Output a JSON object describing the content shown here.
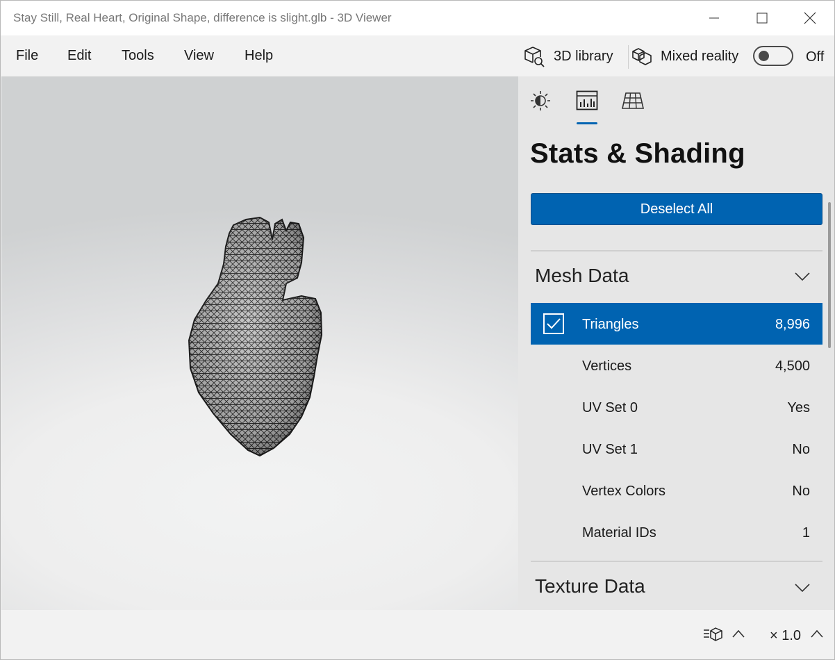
{
  "window": {
    "title": "Stay Still, Real Heart, Original Shape, difference is slight.glb - 3D Viewer",
    "controls": [
      "minimize-icon",
      "maximize-icon",
      "close-icon"
    ]
  },
  "menu": {
    "items": [
      "File",
      "Edit",
      "Tools",
      "View",
      "Help"
    ],
    "library_label": "3D library",
    "mixed_reality_label": "Mixed reality",
    "toggle_state": "Off"
  },
  "panel": {
    "tabs": [
      {
        "name": "lighting-tab",
        "icon": "sun-icon",
        "active": false
      },
      {
        "name": "stats-tab",
        "icon": "stats-icon",
        "active": true
      },
      {
        "name": "grid-tab",
        "icon": "grid-icon",
        "active": false
      }
    ],
    "title": "Stats & Shading",
    "deselect_label": "Deselect All",
    "mesh_section": "Mesh Data",
    "texture_section": "Texture Data",
    "rows": [
      {
        "label": "Triangles",
        "value": "8,996",
        "selected": true
      },
      {
        "label": "Vertices",
        "value": "4,500",
        "selected": false
      },
      {
        "label": "UV Set 0",
        "value": "Yes",
        "selected": false
      },
      {
        "label": "UV Set 1",
        "value": "No",
        "selected": false
      },
      {
        "label": "Vertex Colors",
        "value": "No",
        "selected": false
      },
      {
        "label": "Material IDs",
        "value": "1",
        "selected": false
      }
    ]
  },
  "status": {
    "zoom_label": "× 1.0"
  },
  "colors": {
    "accent": "#0063b1",
    "panel_bg": "#e6e6e6",
    "chrome_bg": "#f2f2f2"
  }
}
